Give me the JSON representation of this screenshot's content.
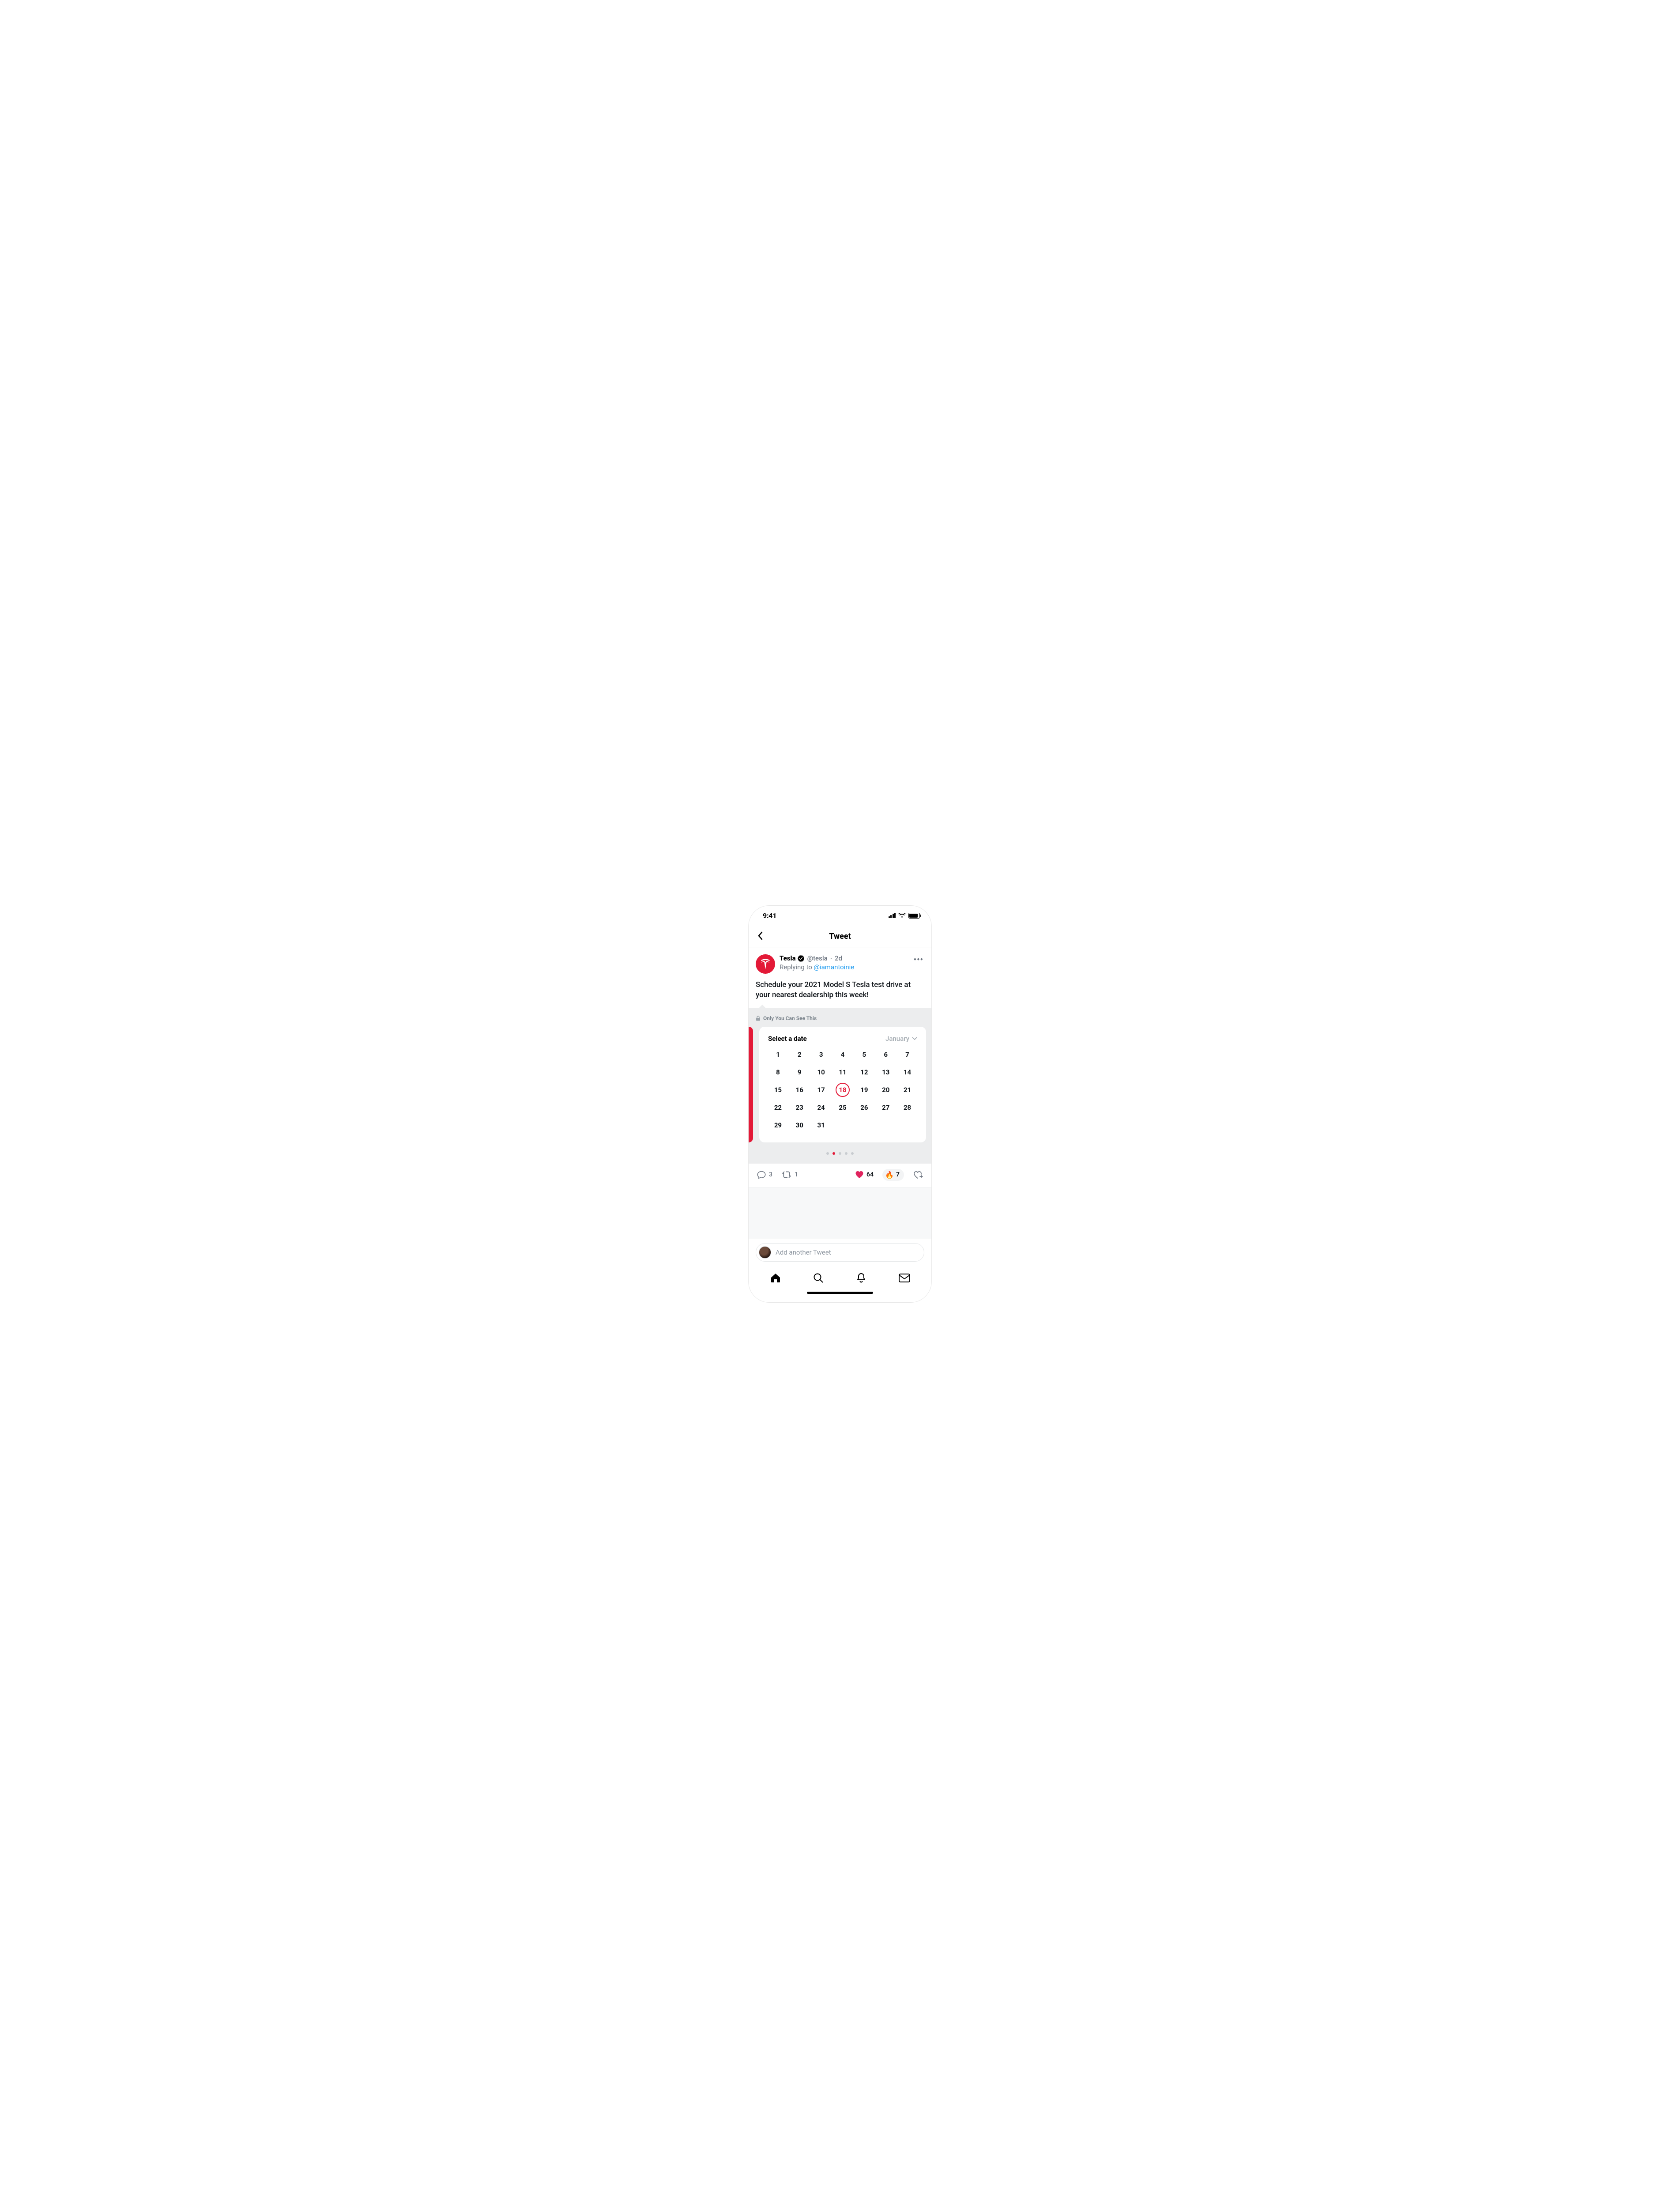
{
  "statusbar": {
    "time": "9:41"
  },
  "nav": {
    "title": "Tweet"
  },
  "tweet": {
    "author_name": "Tesla",
    "author_handle": "@tesla",
    "age": "2d",
    "reply_prefix": "Replying to ",
    "reply_mention": "@iamantoinie",
    "body": "Schedule your 2021 Model S Tesla test drive at your nearest dealership this week!"
  },
  "card": {
    "privacy_label": "Only You Can See This",
    "title": "Select a date",
    "month": "January",
    "selected_day": 18,
    "days": [
      1,
      2,
      3,
      4,
      5,
      6,
      7,
      8,
      9,
      10,
      11,
      12,
      13,
      14,
      15,
      16,
      17,
      18,
      19,
      20,
      21,
      22,
      23,
      24,
      25,
      26,
      27,
      28,
      29,
      30,
      31
    ],
    "page_count": 5,
    "page_active_index": 1
  },
  "actions": {
    "reply_count": "3",
    "retweet_count": "1",
    "like_count": "64",
    "fire_count": "7"
  },
  "composer": {
    "placeholder": "Add another Tweet"
  }
}
